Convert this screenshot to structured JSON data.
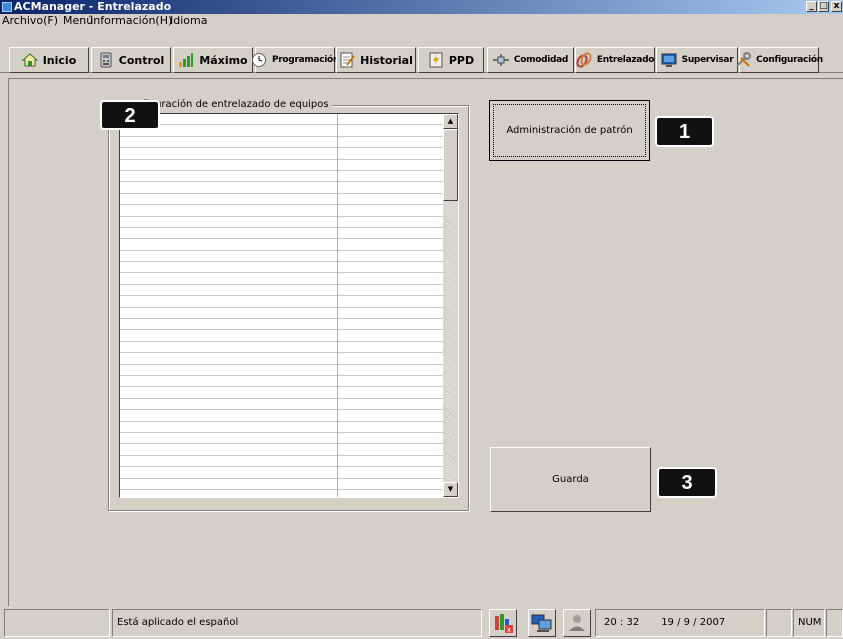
{
  "window": {
    "title": "ACManager - Entrelazado",
    "controls": [
      "_",
      "□",
      "x"
    ]
  },
  "menu": {
    "items": [
      "Archivo(F)",
      "Menú",
      "Información(H)",
      "Idioma"
    ]
  },
  "toolbar": {
    "buttons": [
      {
        "label": "Inicio",
        "icon": "house-icon"
      },
      {
        "label": "Control",
        "icon": "remote-control-icon"
      },
      {
        "label": "Máximo",
        "icon": "bar-chart-icon"
      },
      {
        "label": "Programación",
        "icon": "clock-icon"
      },
      {
        "label": "Historial",
        "icon": "notepad-icon"
      },
      {
        "label": "PPD",
        "icon": "ppd-icon"
      },
      {
        "label": "Comodidad",
        "icon": "network-icon"
      },
      {
        "label": "Entrelazado",
        "icon": "interlock-icon"
      },
      {
        "label": "Supervisar",
        "icon": "monitor-icon"
      },
      {
        "label": "Configuración",
        "icon": "tools-icon"
      }
    ]
  },
  "main": {
    "group_label": "Configuración de entrelazado de equipos",
    "pattern_button": "Administración de patrón",
    "save_button": "Guarda"
  },
  "callouts": [
    "1",
    "2",
    "3"
  ],
  "status": {
    "message": "Está aplicado el español",
    "time": "20 : 32",
    "date": "19 / 9 / 2007",
    "num": "NUM"
  },
  "colors": {
    "titlebar_start": "#0a246a",
    "titlebar_end": "#a6caf0",
    "face": "#d4d0c8"
  }
}
